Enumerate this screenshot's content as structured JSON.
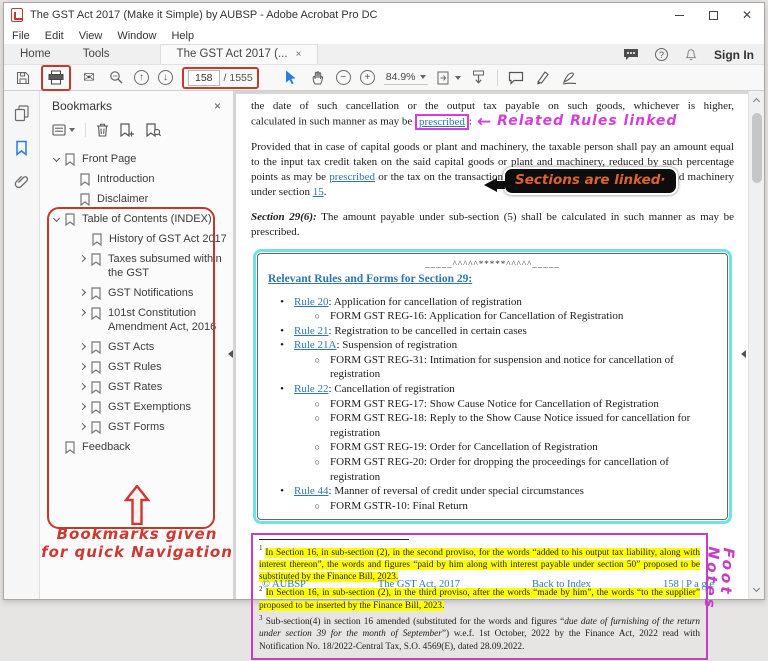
{
  "window": {
    "title": "The GST Act 2017 (Make it Simple) by AUBSP - Adobe Acrobat Pro DC"
  },
  "menu": {
    "items": [
      "File",
      "Edit",
      "View",
      "Window",
      "Help"
    ]
  },
  "tabs": {
    "home": "Home",
    "tools": "Tools",
    "document": "The GST Act 2017 (...",
    "close": "×",
    "sign_in": "Sign In"
  },
  "toolbar": {
    "page_current": "158",
    "page_total": "/ 1555",
    "zoom_level": "84.9%"
  },
  "panel": {
    "title": "Bookmarks",
    "close": "×",
    "items": [
      {
        "label": "Front Page"
      },
      {
        "label": "Introduction"
      },
      {
        "label": "Disclaimer"
      },
      {
        "label": "Table of Contents (INDEX)"
      },
      {
        "label": "History of GST Act 2017"
      },
      {
        "label": "Taxes subsumed within the GST"
      },
      {
        "label": "GST Notifications"
      },
      {
        "label": "101st Constitution Amendment Act, 2016"
      },
      {
        "label": "GST Acts"
      },
      {
        "label": "GST Rules"
      },
      {
        "label": "GST Rates"
      },
      {
        "label": "GST Exemptions"
      },
      {
        "label": "GST Forms"
      },
      {
        "label": "Feedback"
      }
    ],
    "annotation": {
      "line1": "Bookmarks given",
      "line2": "for quick Navigation"
    }
  },
  "doc": {
    "para1_l1": "the date of such cancellation or the output tax payable on such goods, whichever is higher,",
    "para1_pre": "calculated in such manner as may be ",
    "para1_link": "prescribed",
    "para1_post": ":",
    "ann_rules_arrow": "←",
    "ann_rules": "Related Rules linked",
    "para2_pre": "Provided that in case of capital goods or plant and machinery, the taxable person shall pay an amount equal to the input tax credit taken on the said capital goods or plant and machinery, reduced by such percentage points as may be ",
    "para2_link1": "prescribed",
    "para2_mid": " or the tax on the transaction value of such capital goods or plant and machinery under section ",
    "para2_link2": "15",
    "para2_post": ".",
    "ann_sections": "Sections are linked·",
    "para3_label": "Section 29(6):",
    "para3_text": " The amount payable under sub-section (5) shall be calculated in such manner as may be prescribed.",
    "rules_box": {
      "separator": "_____^^^^^*****^^^^^_____",
      "heading": "Relevant Rules and Forms for Section 29:",
      "items": [
        {
          "link": "Rule 20",
          "text": ": Application for cancellation of registration",
          "forms": [
            "FORM GST REG-16: Application for Cancellation of Registration"
          ]
        },
        {
          "link": "Rule 21",
          "text": ": Registration to be cancelled in certain cases",
          "forms": []
        },
        {
          "link": "Rule 21A",
          "text": ": Suspension of registration",
          "forms": [
            "FORM GST REG-31: Intimation for suspension and notice for cancellation of registration"
          ]
        },
        {
          "link": "Rule 22",
          "text": ": Cancellation of registration",
          "forms": [
            "FORM GST REG-17: Show Cause Notice for Cancellation of Registration",
            "FORM GST REG-18: Reply to the Show Cause Notice issued for cancellation for registration",
            "FORM GST REG-19: Order for Cancellation of Registration",
            "FORM GST REG-20: Order for dropping the proceedings for cancellation of registration"
          ]
        },
        {
          "link": "Rule 44",
          "text": ": Manner of reversal of credit under special circumstances",
          "forms": [
            "FORM GSTR-10: Final Return"
          ]
        }
      ]
    },
    "footnotes": {
      "fn1_sup": "1",
      "fn1": "In Section 16, in sub-section (2), in the second proviso, for the words “added to his output tax liability, along with interest thereon”, the words and figures “paid by him along with interest payable under section 50” proposed to be substituted by the Finance Bill, 2023.",
      "fn2_sup": "2",
      "fn2": "In Section 16, in sub-section (2), in the third proviso, after the words “made by him”, the words “to the supplier” proposed to be inserted by the Finance Bill, 2023.",
      "fn3_sup": "3",
      "fn3_pre": "Sub-section(4) in section 16 amended (substituted for the words and figures “",
      "fn3_italic": "due date of furnishing of the return under section 39 for the month of September",
      "fn3_post": "”) w.e.f. 1st October, 2022 by the Finance Act, 2022 read with Notification No. 18/2022-Central Tax, S.O. 4569(E), dated 28.09.2022.",
      "annotation": "Foot Notes"
    },
    "footer": {
      "copyright": "© AUBSP",
      "title": "The GST Act, 2017",
      "back": "Back to Index",
      "page": "158 | P a g e"
    }
  },
  "colors": {
    "annotation_red": "#c0392b",
    "annotation_magenta": "#d63fd6",
    "rules_box_cyan": "#6fe3e3",
    "link_blue": "#2e75b6",
    "highlight_yellow": "#ffff00",
    "callout_text_orange": "#e0622c"
  }
}
